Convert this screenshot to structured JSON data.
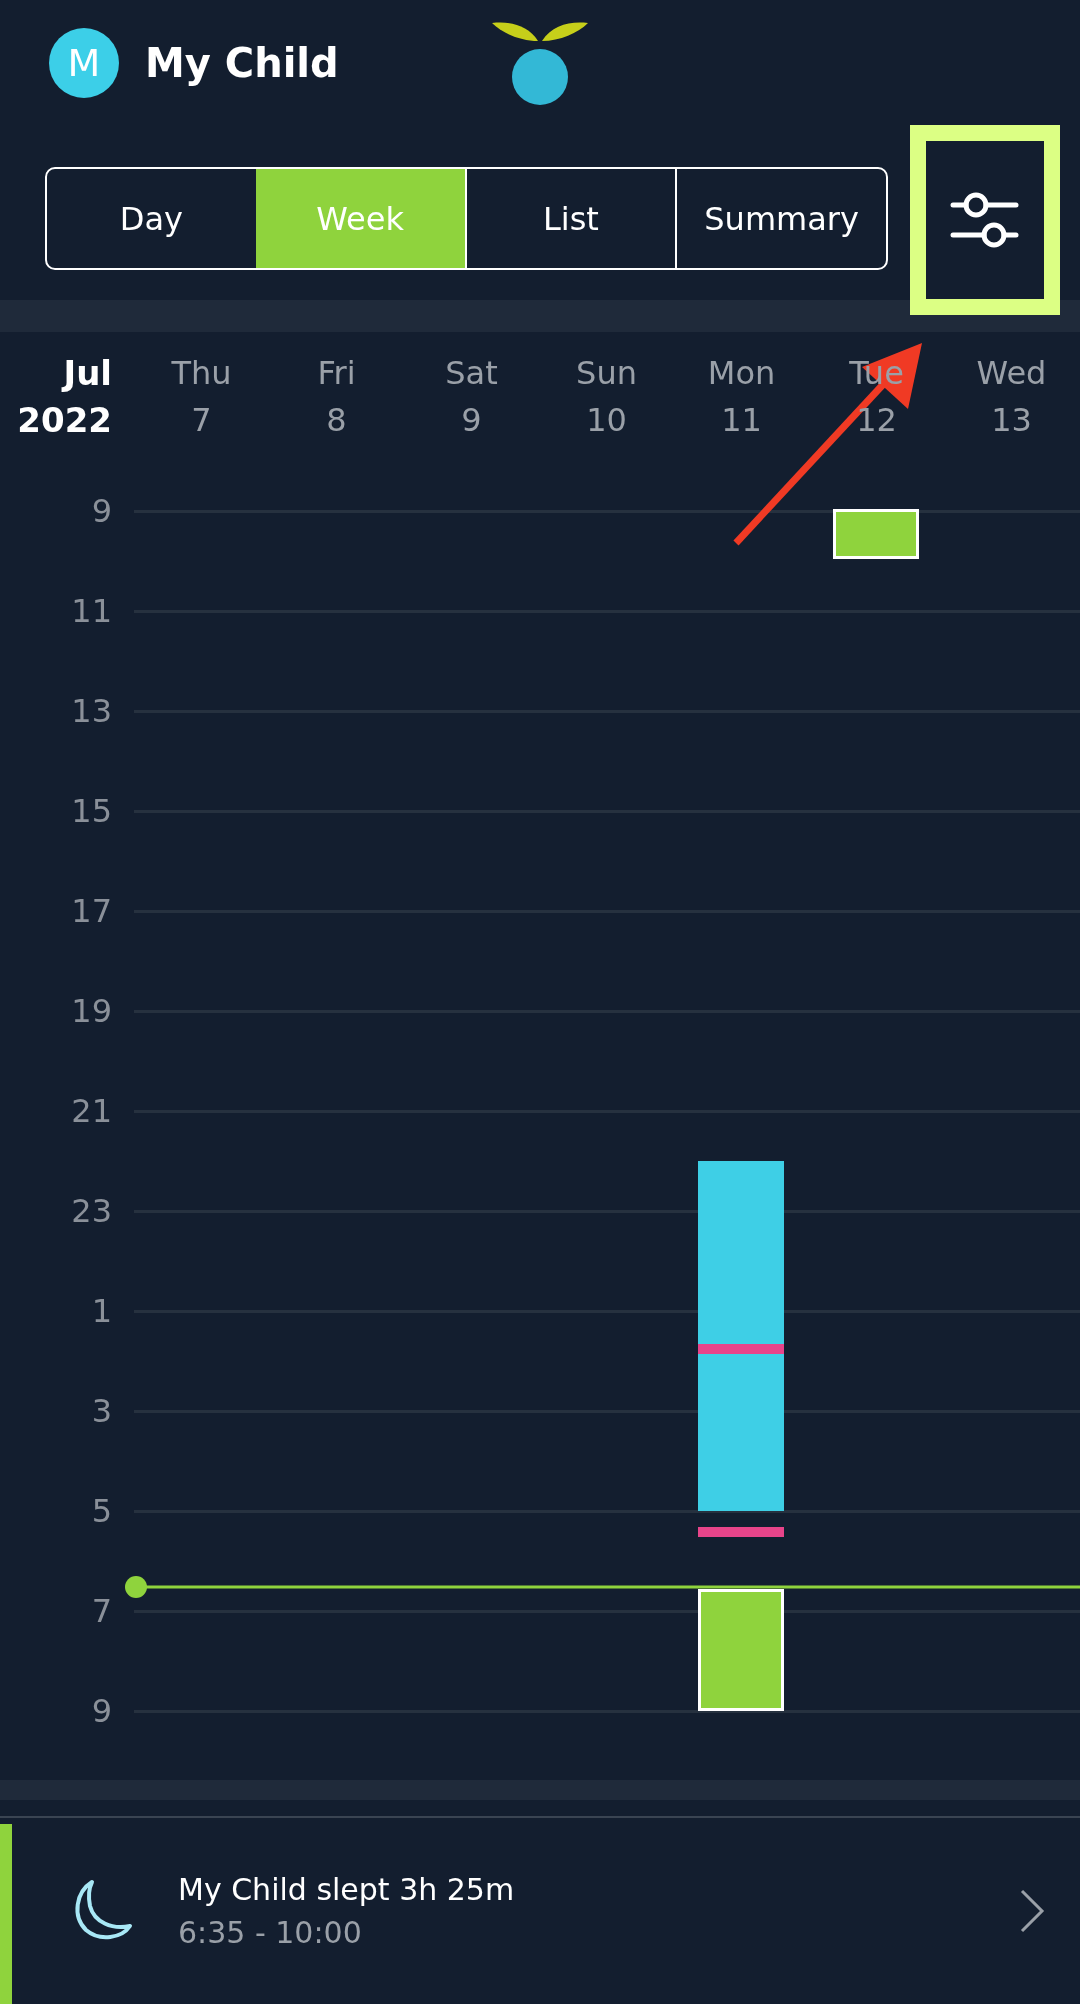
{
  "profile": {
    "initial": "M",
    "name": "My Child"
  },
  "tabs": [
    {
      "label": "Day",
      "selected": false
    },
    {
      "label": "Week",
      "selected": true
    },
    {
      "label": "List",
      "selected": false
    },
    {
      "label": "Summary",
      "selected": false
    }
  ],
  "month": "Jul",
  "year": "2022",
  "days": [
    {
      "weekday": "Thu",
      "date": "7"
    },
    {
      "weekday": "Fri",
      "date": "8"
    },
    {
      "weekday": "Sat",
      "date": "9"
    },
    {
      "weekday": "Sun",
      "date": "10"
    },
    {
      "weekday": "Mon",
      "date": "11"
    },
    {
      "weekday": "Tue",
      "date": "12"
    },
    {
      "weekday": "Wed",
      "date": "13"
    }
  ],
  "hours": [
    "9",
    "11",
    "13",
    "15",
    "17",
    "19",
    "21",
    "23",
    "1",
    "3",
    "5",
    "7",
    "9"
  ],
  "summary": {
    "title": "My Child slept 3h 25m",
    "time": "6:35 - 10:00"
  }
}
